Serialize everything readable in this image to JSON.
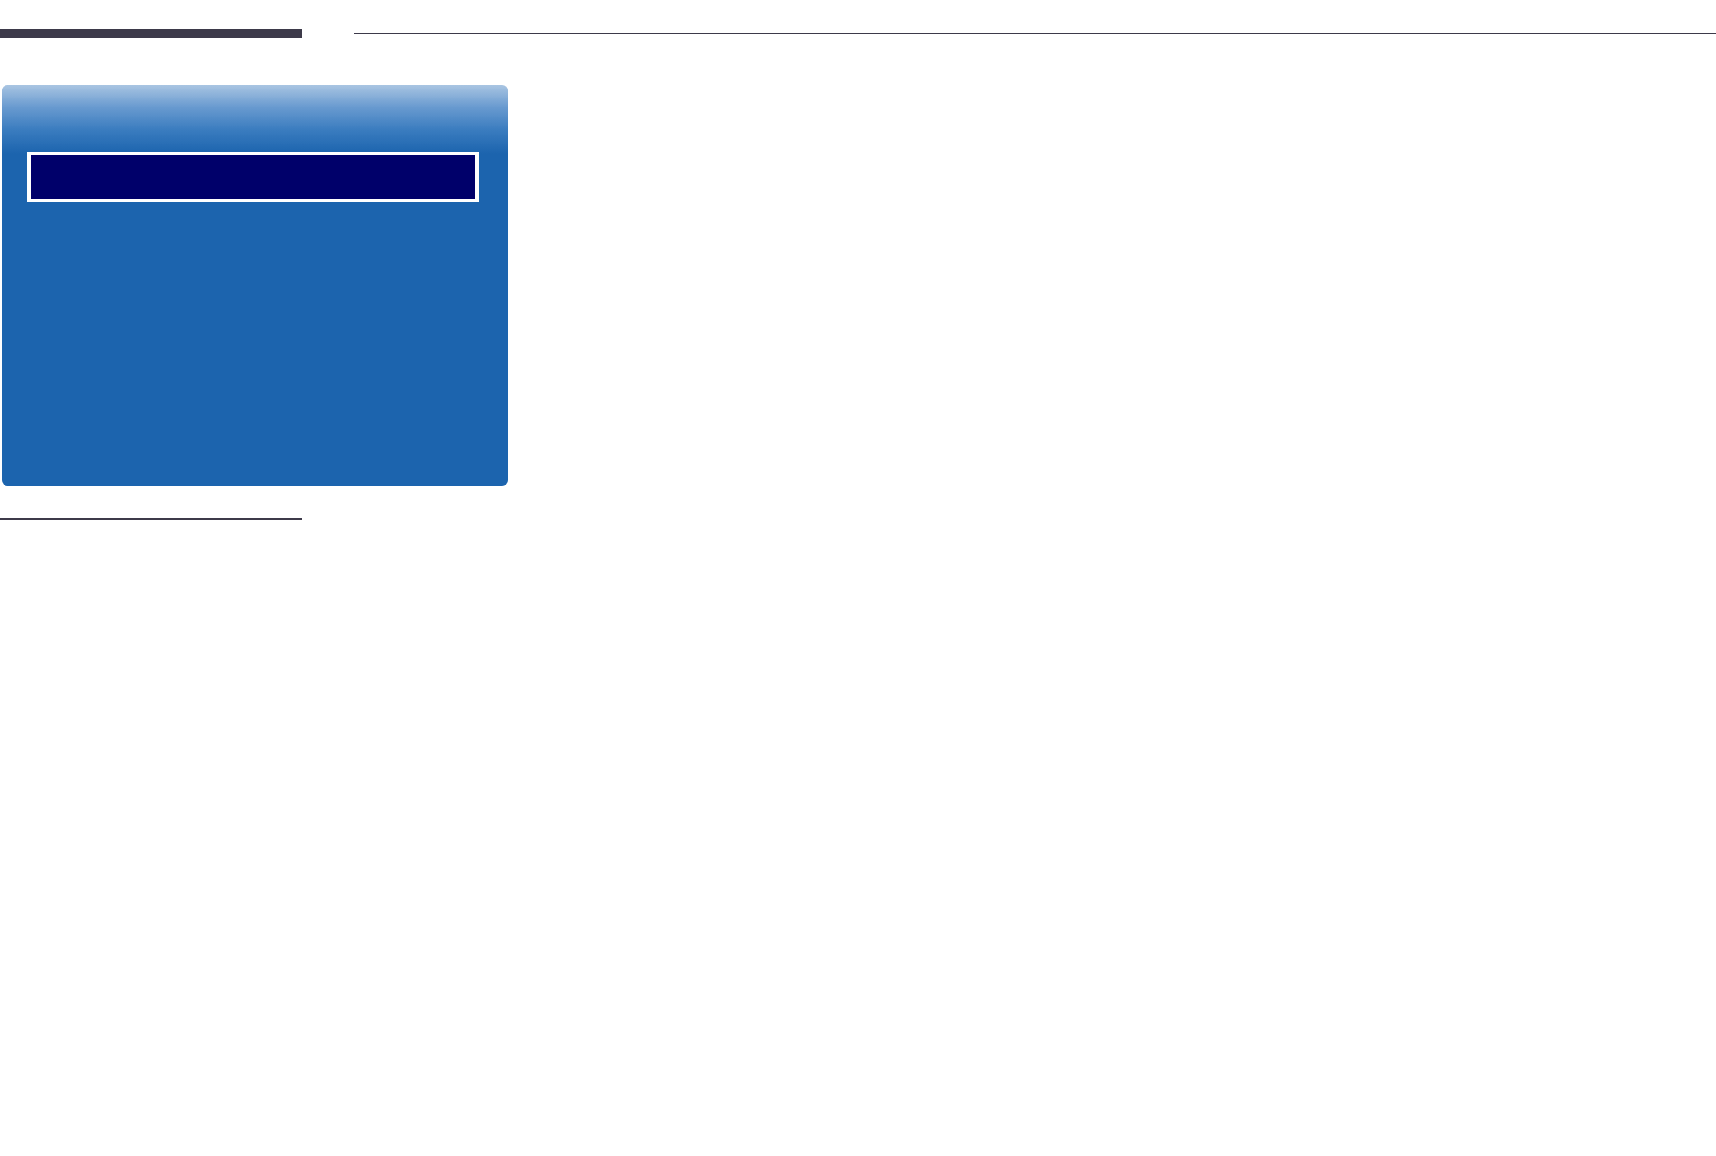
{
  "menu_panel": {
    "items": [
      {
        "selected": true
      }
    ]
  }
}
